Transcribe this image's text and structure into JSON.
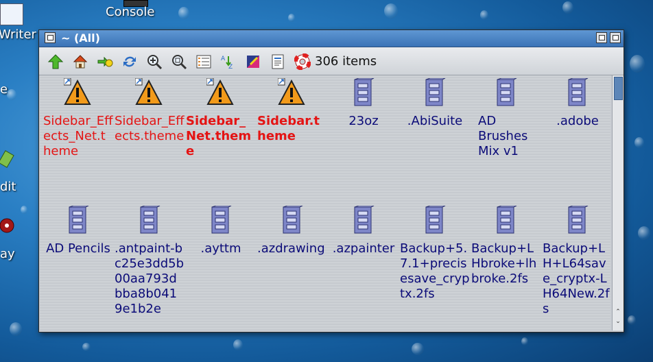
{
  "desktop": {
    "labels": [
      {
        "text": "Console"
      },
      {
        "text": "Writer"
      },
      {
        "text": "dit"
      },
      {
        "text": "ay"
      },
      {
        "text": "e"
      }
    ]
  },
  "window": {
    "title": "~ (All)",
    "item_count": "306 items"
  },
  "toolbar": {
    "tools": [
      "up-arrow-icon",
      "home-icon",
      "bookmark-icon",
      "refresh-icon",
      "zoom-in-icon",
      "zoom-fit-icon",
      "view-details-icon",
      "sort-icon",
      "color-icon",
      "document-icon",
      "help-lifebuoy-icon"
    ]
  },
  "files": [
    {
      "name": "Sidebar_Effects_Net.theme",
      "type": "link-warning",
      "style": "red"
    },
    {
      "name": "Sidebar_Effects.theme",
      "type": "link-warning",
      "style": "red"
    },
    {
      "name": "Sidebar_Net.theme",
      "type": "link-warning",
      "style": "red-bold"
    },
    {
      "name": "Sidebar.theme",
      "type": "link-warning",
      "style": "red-bold"
    },
    {
      "name": "23oz",
      "type": "drawer",
      "style": "normal"
    },
    {
      "name": ".AbiSuite",
      "type": "drawer",
      "style": "normal"
    },
    {
      "name": "AD Brushes Mix v1",
      "type": "drawer",
      "style": "normal"
    },
    {
      "name": ".adobe",
      "type": "drawer",
      "style": "normal"
    },
    {
      "name": "AD Pencils",
      "type": "drawer",
      "style": "normal"
    },
    {
      "name": ".antpaint-bc25e3dd5b00aa793dbba8b0419e1b2e",
      "type": "drawer",
      "style": "normal"
    },
    {
      "name": ".ayttm",
      "type": "drawer",
      "style": "normal"
    },
    {
      "name": ".azdrawing",
      "type": "drawer",
      "style": "normal"
    },
    {
      "name": ".azpainter",
      "type": "drawer",
      "style": "normal"
    },
    {
      "name": "Backup+5.7.1+precisesave_crypt x.2fs",
      "type": "drawer",
      "style": "normal"
    },
    {
      "name": "Backup+LHbroke+lhbroke.2fs",
      "type": "drawer",
      "style": "normal"
    },
    {
      "name": "Backup+LH+L64save_cryptx-LH64New.2fs",
      "type": "drawer",
      "style": "normal"
    }
  ],
  "file_labels": {
    "f0": "Sidebar_Effects_Net.theme",
    "f1": "Sidebar_Effects.theme",
    "f2": "Sidebar_Net.theme",
    "f3": "Sidebar.theme",
    "f4": "23oz",
    "f5": ".AbiSuite",
    "f6": "AD Brushes Mix v1",
    "f7": ".adobe",
    "f8": "AD Pencils",
    "f9": ".antpaint-bc25e3dd5b00aa793dbba8b0419e1b2e",
    "f10": ".ayttm",
    "f11": ".azdrawing",
    "f12": ".azpainter",
    "f13": "Backup+5.7.1+precisesave_cryptx.2fs",
    "f14": "Backup+LHbroke+lhbroke.2fs",
    "f15": "Backup+LH+L64save_cryptx-LH64New.2fs"
  },
  "colors": {
    "link_text": "#e41414",
    "file_text": "#0b0b78",
    "titlebar": "#3a73b6"
  }
}
